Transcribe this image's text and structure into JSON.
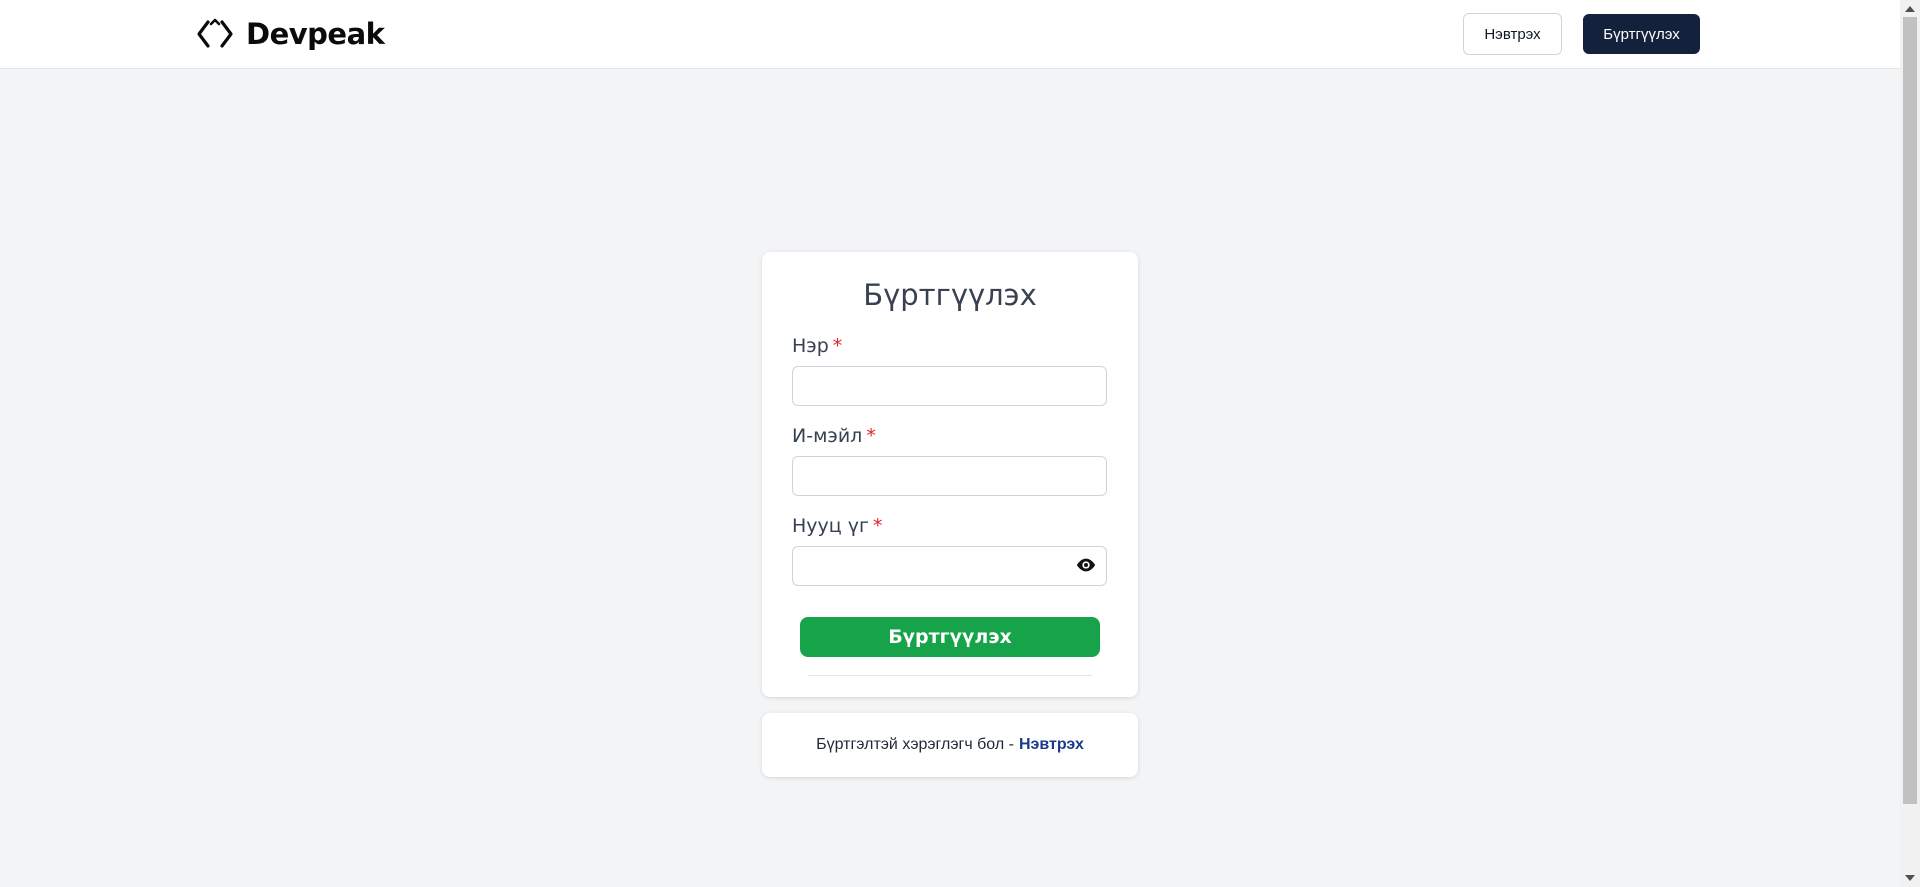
{
  "header": {
    "brand": "Devpeak",
    "login_label": "Нэвтрэх",
    "register_label": "Бүртгүүлэх"
  },
  "form": {
    "title": "Бүртгүүлэх",
    "fields": [
      {
        "label": "Нэр",
        "required_mark": "*",
        "value": ""
      },
      {
        "label": "И-мэйл",
        "required_mark": "*",
        "value": ""
      },
      {
        "label": "Нууц үг",
        "required_mark": "*",
        "value": ""
      }
    ],
    "password_toggle_icon": "eye-icon",
    "submit_label": "Бүртгүүлэх"
  },
  "footer": {
    "prompt": "Бүртгэлтэй хэрэглэгч бол -",
    "link_label": "Нэвтрэх"
  },
  "colors": {
    "background": "#f3f4f6",
    "header_register_bg": "#14213d",
    "submit_bg": "#16a34a",
    "required": "#dc2626",
    "link": "#1e3a8a"
  }
}
